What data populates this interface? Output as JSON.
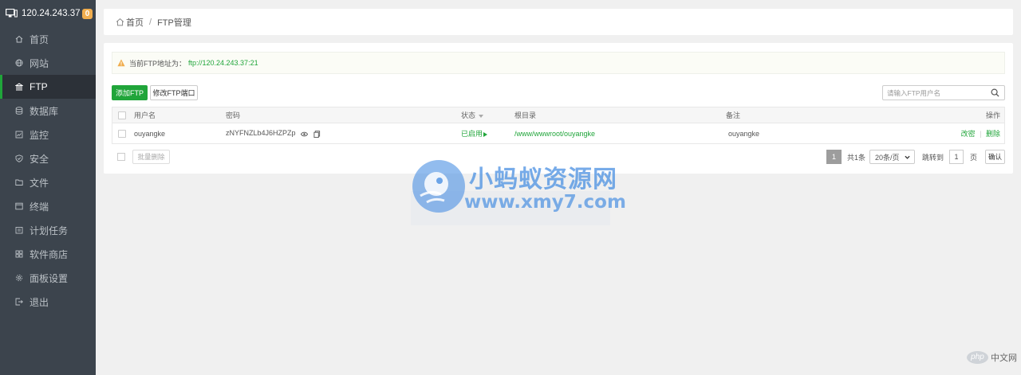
{
  "sidebar": {
    "server_ip": "120.24.243.37",
    "badge_count": "0",
    "items": [
      {
        "label": "首页",
        "icon": "home-icon"
      },
      {
        "label": "网站",
        "icon": "globe-icon"
      },
      {
        "label": "FTP",
        "icon": "ftp-icon",
        "active": true
      },
      {
        "label": "数据库",
        "icon": "database-icon"
      },
      {
        "label": "监控",
        "icon": "monitor-icon"
      },
      {
        "label": "安全",
        "icon": "shield-icon"
      },
      {
        "label": "文件",
        "icon": "folder-icon"
      },
      {
        "label": "终端",
        "icon": "terminal-icon"
      },
      {
        "label": "计划任务",
        "icon": "calendar-icon"
      },
      {
        "label": "软件商店",
        "icon": "apps-icon"
      },
      {
        "label": "面板设置",
        "icon": "gear-icon"
      },
      {
        "label": "退出",
        "icon": "logout-icon"
      }
    ]
  },
  "breadcrumb": {
    "home": "首页",
    "separator": "/",
    "current": "FTP管理"
  },
  "alert": {
    "label": "当前FTP地址为：",
    "address": "ftp://120.24.243.37:21"
  },
  "toolbar": {
    "add_label": "添加FTP",
    "port_label": "修改FTP端口",
    "search_placeholder": "请输入FTP用户名"
  },
  "table": {
    "headers": {
      "username": "用户名",
      "password": "密码",
      "status": "状态",
      "root": "根目录",
      "remark": "备注",
      "actions": "操作"
    },
    "rows": [
      {
        "username": "ouyangke",
        "password": "zNYFNZLb4J6HZPZp",
        "status": "已启用",
        "root": "/www/wwwroot/ouyangke",
        "remark": "ouyangke",
        "action_edit": "改密",
        "action_sep": "|",
        "action_delete": "删除"
      }
    ]
  },
  "footer": {
    "batch_delete": "批量删除",
    "current_page": "1",
    "total": "共1条",
    "per_page": "20条/页",
    "jump_label": "跳转到",
    "jump_value": "1",
    "page_unit": "页",
    "confirm": "确认"
  },
  "watermark": {
    "title": "小蚂蚁资源网",
    "url": "www.xmy7.com"
  },
  "php_badge": {
    "logo": "php",
    "text": "中文网"
  },
  "colors": {
    "accent": "#20a53a",
    "sidebar_bg": "#3c444d",
    "sidebar_active": "#2c3138",
    "badge": "#f0ad4e"
  }
}
